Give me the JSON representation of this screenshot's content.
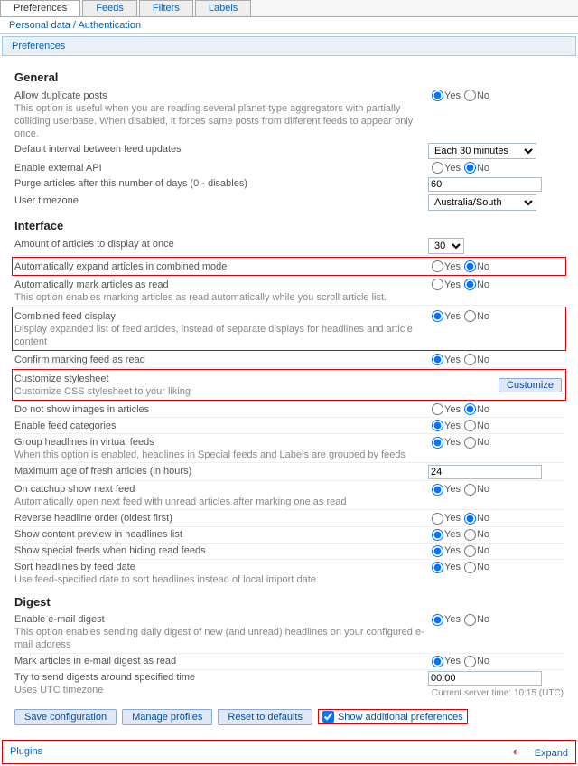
{
  "tabs": {
    "preferences": "Preferences",
    "feeds": "Feeds",
    "filters": "Filters",
    "labels": "Labels"
  },
  "subnav": "Personal data / Authentication",
  "panel_title": "Preferences",
  "yes": "Yes",
  "no": "No",
  "sections": {
    "general": {
      "title": "General",
      "allow_dup": {
        "label": "Allow duplicate posts",
        "help": "This option is useful when you are reading several planet-type aggregators with partially colliding userbase. When disabled, it forces same posts from different feeds to appear only once."
      },
      "default_interval": {
        "label": "Default interval between feed updates",
        "value": "Each 30 minutes"
      },
      "enable_api": {
        "label": "Enable external API"
      },
      "purge": {
        "label": "Purge articles after this number of days (0 - disables)",
        "value": "60"
      },
      "tz": {
        "label": "User timezone",
        "value": "Australia/South"
      }
    },
    "interface": {
      "title": "Interface",
      "amount": {
        "label": "Amount of articles to display at once",
        "value": "30"
      },
      "auto_expand": {
        "label": "Automatically expand articles in combined mode"
      },
      "auto_mark": {
        "label": "Automatically mark articles as read",
        "help": "This option enables marking articles as read automatically while you scroll article list."
      },
      "combined": {
        "label": "Combined feed display",
        "help": "Display expanded list of feed articles, instead of separate displays for headlines and article content"
      },
      "confirm": {
        "label": "Confirm marking feed as read"
      },
      "custom_css": {
        "label": "Customize stylesheet",
        "help": "Customize CSS stylesheet to your liking",
        "button": "Customize"
      },
      "no_images": {
        "label": "Do not show images in articles"
      },
      "feed_cats": {
        "label": "Enable feed categories"
      },
      "group_virt": {
        "label": "Group headlines in virtual feeds",
        "help": "When this option is enabled, headlines in Special feeds and Labels are grouped by feeds"
      },
      "max_age": {
        "label": "Maximum age of fresh articles (in hours)",
        "value": "24"
      },
      "catchup": {
        "label": "On catchup show next feed",
        "help": "Automatically open next feed with unread articles after marking one as read"
      },
      "reverse": {
        "label": "Reverse headline order (oldest first)"
      },
      "content_prev": {
        "label": "Show content preview in headlines list"
      },
      "special_hide": {
        "label": "Show special feeds when hiding read feeds"
      },
      "sort_date": {
        "label": "Sort headlines by feed date",
        "help": "Use feed-specified date to sort headlines instead of local import date."
      }
    },
    "digest": {
      "title": "Digest",
      "enable": {
        "label": "Enable e-mail digest",
        "help": "This option enables sending daily digest of new (and unread) headlines on your configured e-mail address"
      },
      "mark_read": {
        "label": "Mark articles in e-mail digest as read"
      },
      "send_time": {
        "label": "Try to send digests around specified time",
        "help": "Uses UTC timezone",
        "value": "00:00",
        "server": "Current server time: 10:15 (UTC)"
      }
    }
  },
  "buttons": {
    "save": "Save configuration",
    "manage": "Manage profiles",
    "reset": "Reset to defaults",
    "show_add": "Show additional preferences"
  },
  "plugins": {
    "title": "Plugins",
    "expand": "Expand"
  }
}
